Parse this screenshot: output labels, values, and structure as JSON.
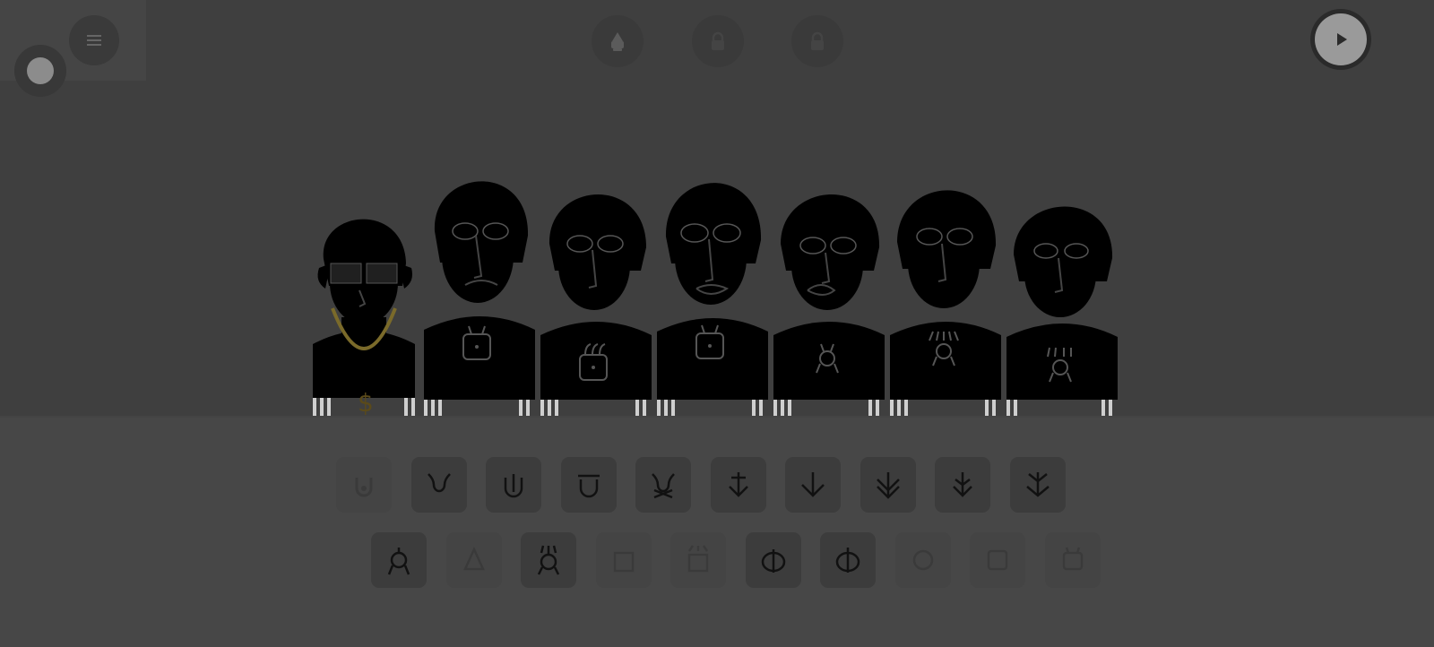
{
  "scene": {
    "stage_color": "#3f3f3f",
    "floor_color": "#474747",
    "overlay_dimmed": true
  },
  "top_left": {
    "menu_icon": "hamburger-menu-icon",
    "record_icon": "record-dot-icon"
  },
  "bonus_buttons": [
    {
      "icon": "unlocked-bonus-icon",
      "state": "unlocked"
    },
    {
      "icon": "lock-icon",
      "state": "locked"
    },
    {
      "icon": "lock-icon",
      "state": "locked"
    }
  ],
  "play_button": {
    "icon": "play-icon"
  },
  "characters": [
    {
      "name": "character-1",
      "accessory": "gold-chain-sunglasses",
      "emblem": "dollar"
    },
    {
      "name": "character-2",
      "emblem": "tv-box"
    },
    {
      "name": "character-3",
      "emblem": "box-rings"
    },
    {
      "name": "character-4",
      "emblem": "tv-box"
    },
    {
      "name": "character-5",
      "emblem": "stick-figure"
    },
    {
      "name": "character-6",
      "emblem": "crown-figure"
    },
    {
      "name": "character-7",
      "emblem": "crown-figure-2"
    }
  ],
  "sound_rows": [
    {
      "row": "beats",
      "icons": [
        {
          "icon": "u-lock-icon",
          "used": true
        },
        {
          "icon": "horns-u-icon",
          "used": false
        },
        {
          "icon": "u-rod-icon",
          "used": false
        },
        {
          "icon": "u-flat-icon",
          "used": false
        },
        {
          "icon": "horns-cross-icon",
          "used": false
        },
        {
          "icon": "arrow-down-split-icon",
          "used": false
        },
        {
          "icon": "arrow-down-icon",
          "used": false
        },
        {
          "icon": "double-arrow-down-icon",
          "used": false
        },
        {
          "icon": "arrow-down-split-2-icon",
          "used": false
        },
        {
          "icon": "arrow-down-v-icon",
          "used": false
        }
      ]
    },
    {
      "row": "voices",
      "icons": [
        {
          "icon": "stick-figure-icon",
          "used": false
        },
        {
          "icon": "triangle-figure-icon",
          "used": true
        },
        {
          "icon": "crown-figure-icon",
          "used": false
        },
        {
          "icon": "square-figure-icon",
          "used": true
        },
        {
          "icon": "crown-square-icon",
          "used": true
        },
        {
          "icon": "split-circle-icon",
          "used": false
        },
        {
          "icon": "split-circle-2-icon",
          "used": false
        },
        {
          "icon": "circle-frame-icon",
          "used": true
        },
        {
          "icon": "square-frame-icon",
          "used": true
        },
        {
          "icon": "tv-box-icon",
          "used": true
        }
      ]
    }
  ]
}
